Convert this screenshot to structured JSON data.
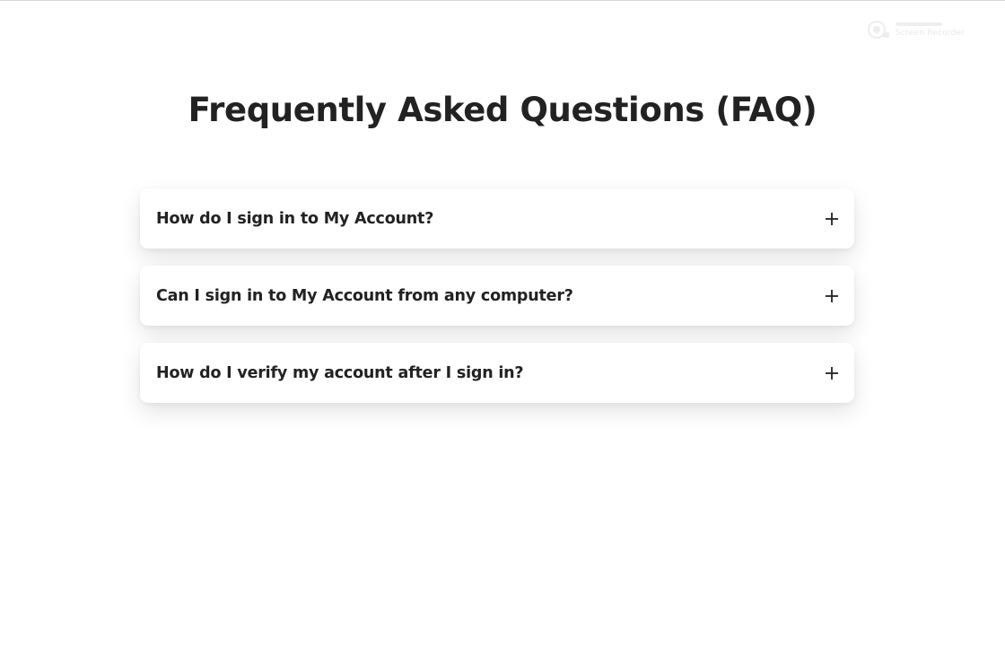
{
  "page": {
    "title": "Frequently Asked Questions (FAQ)"
  },
  "faq": {
    "items": [
      {
        "question": "How do I sign in to My Account?",
        "expanded": false,
        "icon": "plus-icon"
      },
      {
        "question": "Can I sign in to My Account from any computer?",
        "expanded": false,
        "icon": "plus-icon"
      },
      {
        "question": "How do I verify my account after I sign in?",
        "expanded": false,
        "icon": "plus-icon"
      }
    ]
  },
  "watermark": {
    "icon": "screen-recorder-icon",
    "text": "Screen Recorder"
  },
  "colors": {
    "background": "#ffffff",
    "text": "#222222",
    "card": "#ffffff"
  }
}
